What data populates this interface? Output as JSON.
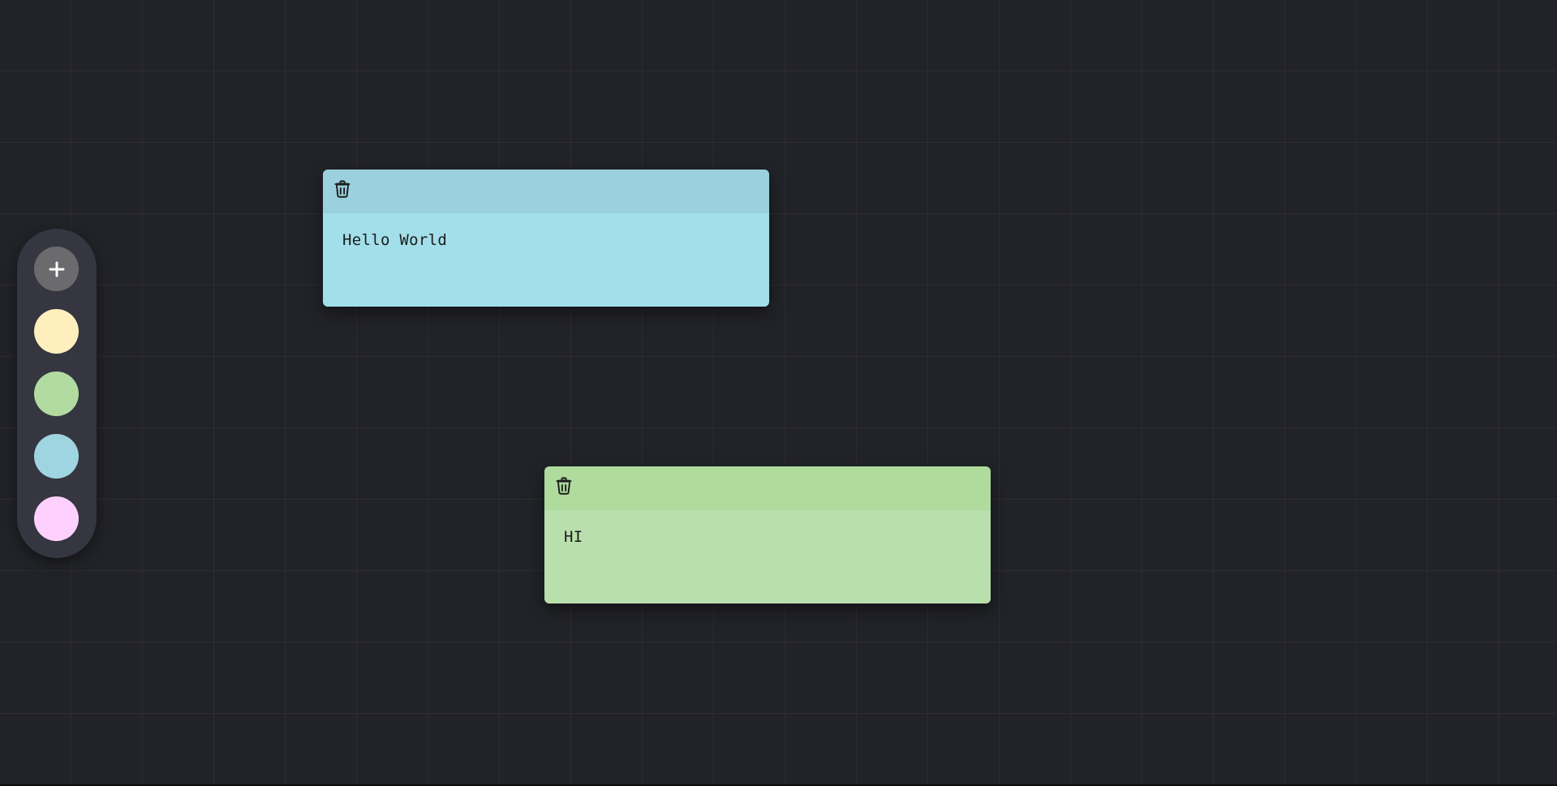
{
  "toolbar": {
    "add_button": {
      "icon": "plus-icon",
      "color": "#6b6b6e"
    },
    "color_swatches": [
      {
        "name": "yellow",
        "color": "#ffefbf"
      },
      {
        "name": "green",
        "color": "#b1dba1"
      },
      {
        "name": "blue",
        "color": "#9fd5e1"
      },
      {
        "name": "pink",
        "color": "#fdd0fd"
      }
    ]
  },
  "notes": [
    {
      "id": "note-1",
      "text": "Hello World",
      "header_color": "#9bd1df",
      "body_color": "#a3dfea",
      "delete_icon": "trash-icon"
    },
    {
      "id": "note-2",
      "text": "HI",
      "header_color": "#afdb9d",
      "body_color": "#b9dfad",
      "delete_icon": "trash-icon"
    }
  ]
}
